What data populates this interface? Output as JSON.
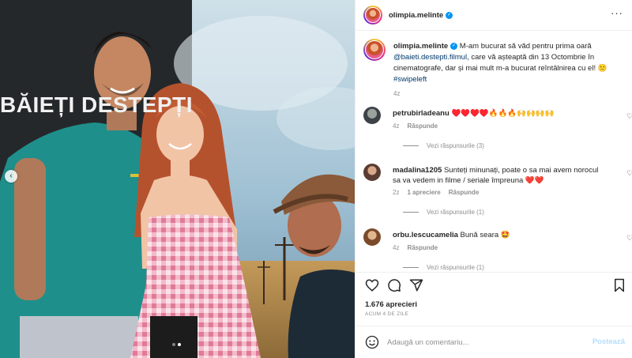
{
  "post": {
    "poster_title": "BĂIEȚI DESTEPȚI",
    "carousel_prev": "‹",
    "slides": 2,
    "active_slide": 2
  },
  "header": {
    "username": "olimpia.melinte",
    "verified_mark": "✓",
    "more_label": "···"
  },
  "caption": {
    "username": "olimpia.melinte",
    "text_before_link": " M-am bucurat să văd pentru prima oară ",
    "link": "@baieti.destepti.filmul",
    "text_after_link": ", care vă așteaptă din 13 Octombrie în cinematografe, dar și mai mult m-a bucurat reîntâlnirea cu el! 🙂",
    "hashtag": "#swipeleft",
    "age": "4z"
  },
  "comments": [
    {
      "username": "petrubirladeanu",
      "text": "♥️♥️♥️♥️🔥🔥🔥🙌🙌🙌🙌",
      "age": "4z",
      "likes": "",
      "reply_label": "Răspunde",
      "view_replies": "Vezi răspunsurile (3)"
    },
    {
      "username": "madalina1205",
      "text": "Sunteți minunați, poate o sa mai avem norocul sa va vedem in filme / seriale împreuna ❤️❤️",
      "age": "2z",
      "likes": "1 apreciere",
      "reply_label": "Răspunde",
      "view_replies": "Vezi răspunsurile (1)"
    },
    {
      "username": "orbu.lescucamelia",
      "text": "Bună seara 🤩",
      "age": "4z",
      "likes": "",
      "reply_label": "Răspunde",
      "view_replies": "Vezi răspunsurile (1)"
    }
  ],
  "actions": {
    "icons": [
      "heart-icon",
      "comment-icon",
      "share-icon",
      "bookmark-icon"
    ]
  },
  "likes_count": "1.676 aprecieri",
  "posted_ago": "ACUM 4 DE ZILE",
  "add_comment": {
    "placeholder": "Adaugă un comentariu...",
    "post_label": "Postează"
  },
  "colors": {
    "accent": "#0095f6",
    "link": "#00376b",
    "muted": "#8e8e8e",
    "post_disabled": "#b2dffc"
  }
}
